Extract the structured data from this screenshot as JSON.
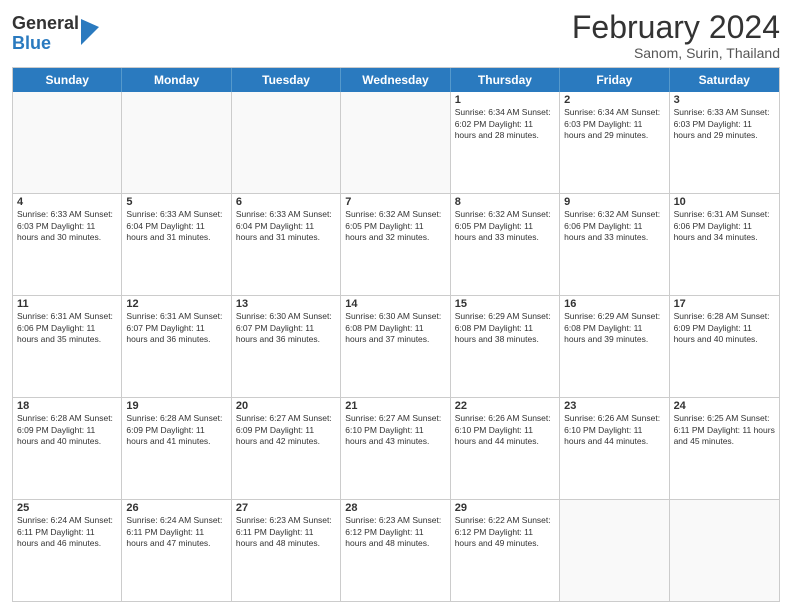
{
  "header": {
    "logo": {
      "general": "General",
      "blue": "Blue"
    },
    "title": "February 2024",
    "location": "Sanom, Surin, Thailand"
  },
  "days": [
    "Sunday",
    "Monday",
    "Tuesday",
    "Wednesday",
    "Thursday",
    "Friday",
    "Saturday"
  ],
  "rows": [
    [
      {
        "day": "",
        "info": ""
      },
      {
        "day": "",
        "info": ""
      },
      {
        "day": "",
        "info": ""
      },
      {
        "day": "",
        "info": ""
      },
      {
        "day": "1",
        "info": "Sunrise: 6:34 AM\nSunset: 6:02 PM\nDaylight: 11 hours and 28 minutes."
      },
      {
        "day": "2",
        "info": "Sunrise: 6:34 AM\nSunset: 6:03 PM\nDaylight: 11 hours and 29 minutes."
      },
      {
        "day": "3",
        "info": "Sunrise: 6:33 AM\nSunset: 6:03 PM\nDaylight: 11 hours and 29 minutes."
      }
    ],
    [
      {
        "day": "4",
        "info": "Sunrise: 6:33 AM\nSunset: 6:03 PM\nDaylight: 11 hours and 30 minutes."
      },
      {
        "day": "5",
        "info": "Sunrise: 6:33 AM\nSunset: 6:04 PM\nDaylight: 11 hours and 31 minutes."
      },
      {
        "day": "6",
        "info": "Sunrise: 6:33 AM\nSunset: 6:04 PM\nDaylight: 11 hours and 31 minutes."
      },
      {
        "day": "7",
        "info": "Sunrise: 6:32 AM\nSunset: 6:05 PM\nDaylight: 11 hours and 32 minutes."
      },
      {
        "day": "8",
        "info": "Sunrise: 6:32 AM\nSunset: 6:05 PM\nDaylight: 11 hours and 33 minutes."
      },
      {
        "day": "9",
        "info": "Sunrise: 6:32 AM\nSunset: 6:06 PM\nDaylight: 11 hours and 33 minutes."
      },
      {
        "day": "10",
        "info": "Sunrise: 6:31 AM\nSunset: 6:06 PM\nDaylight: 11 hours and 34 minutes."
      }
    ],
    [
      {
        "day": "11",
        "info": "Sunrise: 6:31 AM\nSunset: 6:06 PM\nDaylight: 11 hours and 35 minutes."
      },
      {
        "day": "12",
        "info": "Sunrise: 6:31 AM\nSunset: 6:07 PM\nDaylight: 11 hours and 36 minutes."
      },
      {
        "day": "13",
        "info": "Sunrise: 6:30 AM\nSunset: 6:07 PM\nDaylight: 11 hours and 36 minutes."
      },
      {
        "day": "14",
        "info": "Sunrise: 6:30 AM\nSunset: 6:08 PM\nDaylight: 11 hours and 37 minutes."
      },
      {
        "day": "15",
        "info": "Sunrise: 6:29 AM\nSunset: 6:08 PM\nDaylight: 11 hours and 38 minutes."
      },
      {
        "day": "16",
        "info": "Sunrise: 6:29 AM\nSunset: 6:08 PM\nDaylight: 11 hours and 39 minutes."
      },
      {
        "day": "17",
        "info": "Sunrise: 6:28 AM\nSunset: 6:09 PM\nDaylight: 11 hours and 40 minutes."
      }
    ],
    [
      {
        "day": "18",
        "info": "Sunrise: 6:28 AM\nSunset: 6:09 PM\nDaylight: 11 hours and 40 minutes."
      },
      {
        "day": "19",
        "info": "Sunrise: 6:28 AM\nSunset: 6:09 PM\nDaylight: 11 hours and 41 minutes."
      },
      {
        "day": "20",
        "info": "Sunrise: 6:27 AM\nSunset: 6:09 PM\nDaylight: 11 hours and 42 minutes."
      },
      {
        "day": "21",
        "info": "Sunrise: 6:27 AM\nSunset: 6:10 PM\nDaylight: 11 hours and 43 minutes."
      },
      {
        "day": "22",
        "info": "Sunrise: 6:26 AM\nSunset: 6:10 PM\nDaylight: 11 hours and 44 minutes."
      },
      {
        "day": "23",
        "info": "Sunrise: 6:26 AM\nSunset: 6:10 PM\nDaylight: 11 hours and 44 minutes."
      },
      {
        "day": "24",
        "info": "Sunrise: 6:25 AM\nSunset: 6:11 PM\nDaylight: 11 hours and 45 minutes."
      }
    ],
    [
      {
        "day": "25",
        "info": "Sunrise: 6:24 AM\nSunset: 6:11 PM\nDaylight: 11 hours and 46 minutes."
      },
      {
        "day": "26",
        "info": "Sunrise: 6:24 AM\nSunset: 6:11 PM\nDaylight: 11 hours and 47 minutes."
      },
      {
        "day": "27",
        "info": "Sunrise: 6:23 AM\nSunset: 6:11 PM\nDaylight: 11 hours and 48 minutes."
      },
      {
        "day": "28",
        "info": "Sunrise: 6:23 AM\nSunset: 6:12 PM\nDaylight: 11 hours and 48 minutes."
      },
      {
        "day": "29",
        "info": "Sunrise: 6:22 AM\nSunset: 6:12 PM\nDaylight: 11 hours and 49 minutes."
      },
      {
        "day": "",
        "info": ""
      },
      {
        "day": "",
        "info": ""
      }
    ]
  ]
}
